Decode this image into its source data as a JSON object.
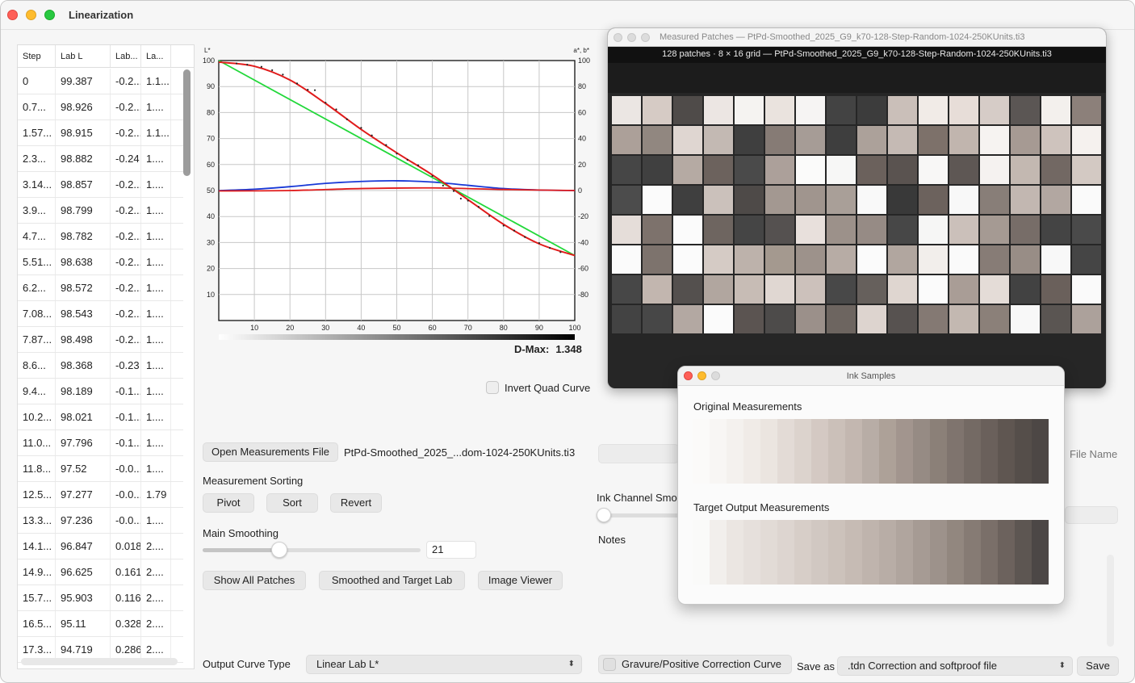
{
  "window": {
    "title": "Linearization"
  },
  "table": {
    "columns": [
      "Step",
      "Lab L",
      "Lab...",
      "La..."
    ],
    "rows": [
      [
        "0",
        "99.387",
        "-0.2...",
        "1.1..."
      ],
      [
        "0.7...",
        "98.926",
        "-0.2...",
        "1...."
      ],
      [
        "1.57...",
        "98.915",
        "-0.2...",
        "1.1..."
      ],
      [
        "2.3...",
        "98.882",
        "-0.24",
        "1...."
      ],
      [
        "3.14...",
        "98.857",
        "-0.2...",
        "1...."
      ],
      [
        "3.9...",
        "98.799",
        "-0.2...",
        "1...."
      ],
      [
        "4.7...",
        "98.782",
        "-0.2...",
        "1...."
      ],
      [
        "5.51...",
        "98.638",
        "-0.2...",
        "1...."
      ],
      [
        "6.2...",
        "98.572",
        "-0.2...",
        "1...."
      ],
      [
        "7.08...",
        "98.543",
        "-0.2...",
        "1...."
      ],
      [
        "7.87...",
        "98.498",
        "-0.2...",
        "1...."
      ],
      [
        "8.6...",
        "98.368",
        "-0.23",
        "1...."
      ],
      [
        "9.4...",
        "98.189",
        "-0.1...",
        "1...."
      ],
      [
        "10.2...",
        "98.021",
        "-0.1...",
        "1...."
      ],
      [
        "11.0...",
        "97.796",
        "-0.1...",
        "1...."
      ],
      [
        "11.8...",
        "97.52",
        "-0.0...",
        "1...."
      ],
      [
        "12.5...",
        "97.277",
        "-0.0...",
        "1.79"
      ],
      [
        "13.3...",
        "97.236",
        "-0.0...",
        "1...."
      ],
      [
        "14.1...",
        "96.847",
        "0.018",
        "2...."
      ],
      [
        "14.9...",
        "96.625",
        "0.161",
        "2...."
      ],
      [
        "15.7...",
        "95.903",
        "0.116",
        "2...."
      ],
      [
        "16.5...",
        "95.11",
        "0.328",
        "2...."
      ],
      [
        "17.3...",
        "94.719",
        "0.286",
        "2...."
      ]
    ]
  },
  "chart": {
    "left_unit": "L*",
    "right_unit": "a*, b*",
    "x_ticks": [
      "10",
      "20",
      "30",
      "40",
      "50",
      "60",
      "70",
      "80",
      "90",
      "100"
    ],
    "left_ticks": [
      "100",
      "90",
      "80",
      "70",
      "60",
      "50",
      "40",
      "30",
      "20",
      "10"
    ],
    "right_ticks": [
      "100",
      "80",
      "60",
      "40",
      "20",
      "0",
      "-20",
      "-40",
      "-60",
      "-80"
    ],
    "dmax_label": "D-Max:",
    "dmax_value": "1.348",
    "colors": {
      "measured": "#e01b1b",
      "target": "#22d83a",
      "b_curve": "#1838d6",
      "a_curve": "#e01b1b",
      "dots": "#222222"
    },
    "series": {
      "target": [
        [
          0,
          100
        ],
        [
          100,
          25
        ]
      ],
      "measured_L": [
        [
          0,
          99.4
        ],
        [
          10,
          97.8
        ],
        [
          20,
          92.5
        ],
        [
          30,
          83.5
        ],
        [
          40,
          73.5
        ],
        [
          50,
          64.5
        ],
        [
          60,
          56
        ],
        [
          70,
          46.5
        ],
        [
          80,
          37
        ],
        [
          90,
          29.5
        ],
        [
          100,
          25
        ]
      ],
      "b_star": [
        [
          0,
          0
        ],
        [
          10,
          1
        ],
        [
          20,
          3
        ],
        [
          30,
          5.5
        ],
        [
          40,
          7
        ],
        [
          50,
          7.5
        ],
        [
          60,
          6.5
        ],
        [
          70,
          4
        ],
        [
          80,
          1.5
        ],
        [
          90,
          0.4
        ],
        [
          100,
          0
        ]
      ],
      "a_star": [
        [
          0,
          -0.3
        ],
        [
          20,
          0
        ],
        [
          40,
          1.5
        ],
        [
          60,
          2
        ],
        [
          80,
          0.8
        ],
        [
          100,
          0
        ]
      ],
      "dots": [
        [
          5,
          98.9
        ],
        [
          8,
          98.4
        ],
        [
          12,
          97.6
        ],
        [
          15,
          96.3
        ],
        [
          18,
          94.6
        ],
        [
          22,
          91.2
        ],
        [
          25,
          88.8
        ],
        [
          27,
          88.6
        ],
        [
          30,
          83.8
        ],
        [
          33,
          81.2
        ],
        [
          36,
          77.4
        ],
        [
          40,
          74.1
        ],
        [
          43,
          71.2
        ],
        [
          47,
          67.5
        ],
        [
          50,
          64.2
        ],
        [
          53,
          61.8
        ],
        [
          56,
          59.7
        ],
        [
          60,
          55.6
        ],
        [
          63,
          51.9
        ],
        [
          66,
          49.8
        ],
        [
          68,
          46.9
        ],
        [
          70,
          46.1
        ],
        [
          73,
          43.7
        ],
        [
          76,
          40.2
        ],
        [
          80,
          36.5
        ],
        [
          83,
          34.6
        ],
        [
          86,
          32.1
        ],
        [
          90,
          29.8
        ],
        [
          93,
          27.9
        ],
        [
          96,
          26.3
        ]
      ]
    }
  },
  "controls": {
    "invert_label": "Invert Quad Curve",
    "open_file_button": "Open Measurements File",
    "file_name": "PtPd-Smoothed_2025_...dom-1024-250KUnits.ti3",
    "measurement_sorting_label": "Measurement Sorting",
    "pivot_button": "Pivot",
    "sort_button": "Sort",
    "revert_button": "Revert",
    "main_smoothing_label": "Main Smoothing",
    "main_smoothing_value": "21",
    "main_smoothing_fraction": 0.35,
    "show_all_button": "Show All Patches",
    "smoothed_button": "Smoothed and Target Lab",
    "image_viewer_button": "Image Viewer",
    "output_curve_label": "Output Curve Type",
    "output_curve_value": "Linear Lab L*",
    "ink_channel_label": "Ink Channel Smo",
    "notes_label": "Notes",
    "file_name_label": "File Name",
    "gravure_label": "Gravure/Positive Correction Curve",
    "save_as_label": "Save as",
    "save_as_value": ".tdn Correction and softproof file",
    "save_button": "Save"
  },
  "patches_window": {
    "title": "Measured Patches — PtPd-Smoothed_2025_G9_k70-128-Step-Random-1024-250KUnits.ti3",
    "header": "128 patches · 8 × 16 grid   —   PtPd-Smoothed_2025_G9_k70-128-Step-Random-1024-250KUnits.ti3",
    "grid": [
      [
        "#ebe6e3",
        "#d6cbc5",
        "#4f4b49",
        "#ece6e3",
        "#f5f3f1",
        "#eae3de",
        "#f6f4f3",
        "#434343",
        "#3c3c3c",
        "#cabfb9",
        "#f1ebe7",
        "#e7ddd8",
        "#d6ccc7",
        "#5b5654",
        "#f3f0ed",
        "#8c807a"
      ],
      [
        "#aca099",
        "#918780",
        "#dfd6d1",
        "#c3b9b3",
        "#3f3f3f",
        "#867b75",
        "#a69c96",
        "#3e3e3e",
        "#aca19a",
        "#c5bab4",
        "#7d716a",
        "#c1b5ae",
        "#f6f3f1",
        "#a69a93",
        "#cec3bd",
        "#f5f1ee"
      ],
      [
        "#464646",
        "#404040",
        "#b5aaa3",
        "#6c625d",
        "#4a4a4a",
        "#aca09a",
        "#fbfbfa",
        "#f7f7f6",
        "#6b615c",
        "#5a5350",
        "#f8f7f6",
        "#5e5754",
        "#f5f2f0",
        "#c3b8b1",
        "#726863",
        "#d3c9c3"
      ],
      [
        "#4c4c4c",
        "#fbfbfb",
        "#3f3f3f",
        "#cbc1bb",
        "#4e4a48",
        "#a39891",
        "#a0958e",
        "#a99f98",
        "#f9f9f9",
        "#393939",
        "#6c625d",
        "#f8f8f8",
        "#887e78",
        "#c2b7b1",
        "#b2a7a1",
        "#fafafa"
      ],
      [
        "#e5ddd9",
        "#7d726c",
        "#fbfbfb",
        "#6e6560",
        "#454545",
        "#555150",
        "#e8e0dc",
        "#9c918a",
        "#968b85",
        "#474747",
        "#f6f6f5",
        "#cbc0ba",
        "#a59a93",
        "#776d68",
        "#444444",
        "#4a4a4a"
      ],
      [
        "#fbfbfb",
        "#7d736d",
        "#fbfbfb",
        "#d5cbc5",
        "#bdb2ab",
        "#a4998f",
        "#9d928b",
        "#b7aca5",
        "#fbfbfb",
        "#b1a69f",
        "#f2eeeb",
        "#fafafa",
        "#877c76",
        "#988d86",
        "#f8f8f8",
        "#454545"
      ],
      [
        "#474747",
        "#c2b6af",
        "#54504e",
        "#b1a69f",
        "#c7bcb5",
        "#e0d7d2",
        "#ccc1bb",
        "#484848",
        "#66605c",
        "#dfd6d0",
        "#fbfbfb",
        "#a99d96",
        "#e4dcd7",
        "#424242",
        "#6a605b",
        "#fafafa"
      ],
      [
        "#434343",
        "#474747",
        "#b3a8a2",
        "#fbfbfb",
        "#5b5451",
        "#4d4b4a",
        "#9b908a",
        "#6d6560",
        "#ddd4cf",
        "#575250",
        "#847973",
        "#c3b8b1",
        "#8b8079",
        "#f8f8f8",
        "#5a5552",
        "#aca19b"
      ]
    ]
  },
  "ink_window": {
    "title": "Ink Samples",
    "original_label": "Original Measurements",
    "target_label": "Target Output Measurements",
    "original": [
      "#fbfaf9",
      "#f8f6f4",
      "#f4f1ee",
      "#f0ebe7",
      "#ebe5e0",
      "#e3dbd6",
      "#dcd3cd",
      "#d4c9c3",
      "#cbc0b9",
      "#c3b7b0",
      "#b8ada6",
      "#ada198",
      "#a2958e",
      "#968b84",
      "#8b8078",
      "#7f746e",
      "#746a64",
      "#6a605b",
      "#5f5651",
      "#554e4a",
      "#4d4745"
    ],
    "target": [
      "#fafaf9",
      "#f2efec",
      "#ebe6e2",
      "#e6e0dc",
      "#e2dbd6",
      "#ddd5d0",
      "#d7cec8",
      "#d1c8c2",
      "#ccc2bb",
      "#c6bbb4",
      "#bfb4ad",
      "#b8ada6",
      "#b0a59e",
      "#a69b94",
      "#9d928b",
      "#92877f",
      "#867b74",
      "#7a6f69",
      "#6c625d",
      "#5d5652",
      "#4c4746"
    ]
  }
}
